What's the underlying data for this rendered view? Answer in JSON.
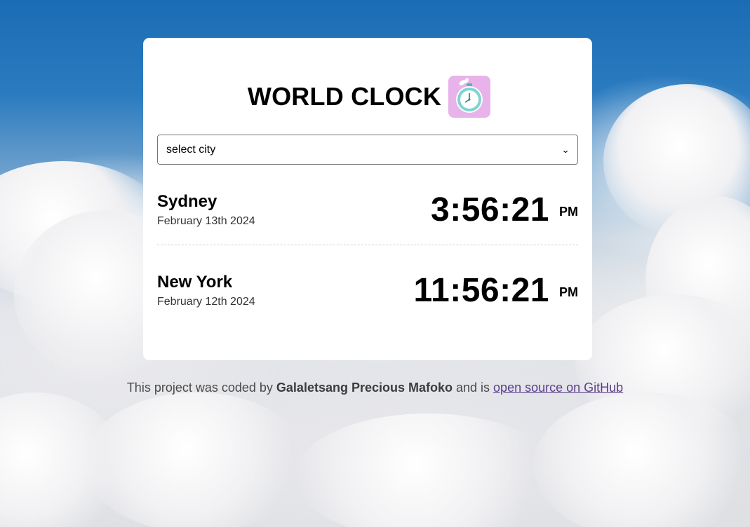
{
  "header": {
    "title": "WORLD CLOCK",
    "icon": "stopwatch-icon"
  },
  "city_select": {
    "selected": "select city"
  },
  "cities": [
    {
      "name": "Sydney",
      "date": "February 13th 2024",
      "time": "3:56:21",
      "period": "PM"
    },
    {
      "name": "New York",
      "date": "February 12th 2024",
      "time": "11:56:21",
      "period": "PM"
    }
  ],
  "footer": {
    "prefix": "This project was coded by ",
    "author": "Galaletsang Precious Mafoko",
    "middle": " and is ",
    "link_text": "open source on GitHub"
  },
  "colors": {
    "icon_background": "#e7b3ea",
    "clock_face": "#7fd3d0",
    "link": "#5a3d8a"
  }
}
